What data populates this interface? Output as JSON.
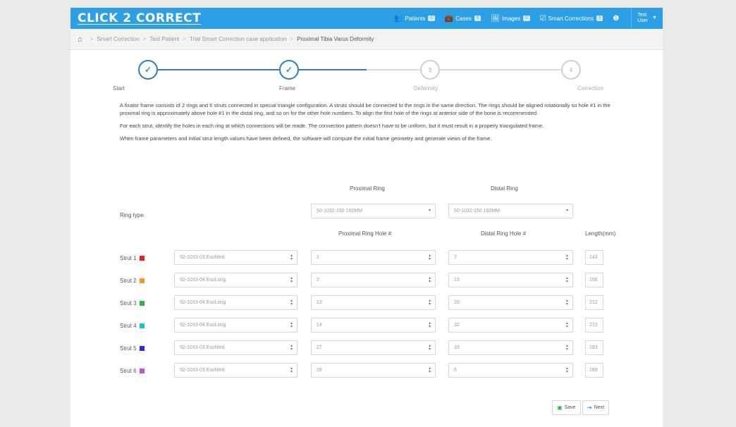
{
  "nav": {
    "brand": "CLICK 2 CORRECT",
    "items": [
      {
        "icon": "users-icon",
        "glyph": "👥",
        "label": "Patients",
        "badge": "0"
      },
      {
        "icon": "briefcase-icon",
        "glyph": "💼",
        "label": "Cases",
        "badge": "0"
      },
      {
        "icon": "image-icon",
        "glyph": "🖼",
        "label": "Images",
        "badge": "0"
      },
      {
        "icon": "checklist-icon",
        "glyph": "☑",
        "label": "Smart Corrections",
        "badge": "0"
      }
    ],
    "info_glyph": "❶",
    "user_line1": "Test",
    "user_line2": "User"
  },
  "breadcrumb": {
    "items": [
      "Smart Correction",
      "Test Patient",
      "Trial Smart Correction case application"
    ],
    "current": "Proximal Tibia Varus Deformity"
  },
  "stepper": {
    "accent": "#2d7fc1",
    "steps": [
      {
        "label": "Start",
        "state": "done",
        "glyph": "✓"
      },
      {
        "label": "Frame",
        "state": "done",
        "glyph": "✓"
      },
      {
        "label": "Deformity",
        "state": "todo",
        "glyph": "3"
      },
      {
        "label": "Correction",
        "state": "todo",
        "glyph": "4"
      }
    ]
  },
  "description": {
    "p1": "A fixator frame consists of 2 rings and 6 struts connected in special triangle configuration. A struts should be connected to the rings in the same direction. The rings should be aligned rotationally so hole #1 in the proximal ring is approximately above hole #1 in the distal ring, and so on for the other hole numbers. To align the first hole of the rings at anterior side of the bone is recommended.",
    "p2": "For each strut, identify the holes in each ring at which connections will be made. The connection pattern doesn't have to be uniform, but it must result in a properly triangulated frame.",
    "p3": "When frame parameters and initial strut length values have been defined, the software will compute the initial frame geometry and generate views of the frame."
  },
  "form": {
    "proximal_ring_header": "Proximal Ring",
    "distal_ring_header": "Distal Ring",
    "ring_type_label": "Ring type",
    "proximal_ring_type": "50-1032-150 160MM",
    "distal_ring_type": "50-1032-150 160MM",
    "proximal_hole_header": "Proximal Ring Hole #",
    "distal_hole_header": "Distal Ring Hole #",
    "length_header": "Length(mm)",
    "struts": [
      {
        "label": "Strut 1",
        "color": "#e8202a",
        "type": "50-1033-03 ExoMed",
        "proximal": "1",
        "distal": "7",
        "length": "143"
      },
      {
        "label": "Strut 2",
        "color": "#f39a1e",
        "type": "50-1033-04 ExoLong",
        "proximal": "2",
        "distal": "13",
        "length": "156"
      },
      {
        "label": "Strut 3",
        "color": "#2bb24c",
        "type": "50-1033-04 ExoLong",
        "proximal": "13",
        "distal": "20",
        "length": "212"
      },
      {
        "label": "Strut 4",
        "color": "#1fc1cf",
        "type": "50-1033-04 ExoLong",
        "proximal": "14",
        "distal": "32",
        "length": "215"
      },
      {
        "label": "Strut 5",
        "color": "#2a2fd6",
        "type": "50-1033-03 ExoMed",
        "proximal": "27",
        "distal": "33",
        "length": "183"
      },
      {
        "label": "Strut 6",
        "color": "#c34fcf",
        "type": "50-1033-03 ExoMed",
        "proximal": "28",
        "distal": "6",
        "length": "169"
      }
    ],
    "save_label": "Save",
    "next_label": "Next"
  }
}
